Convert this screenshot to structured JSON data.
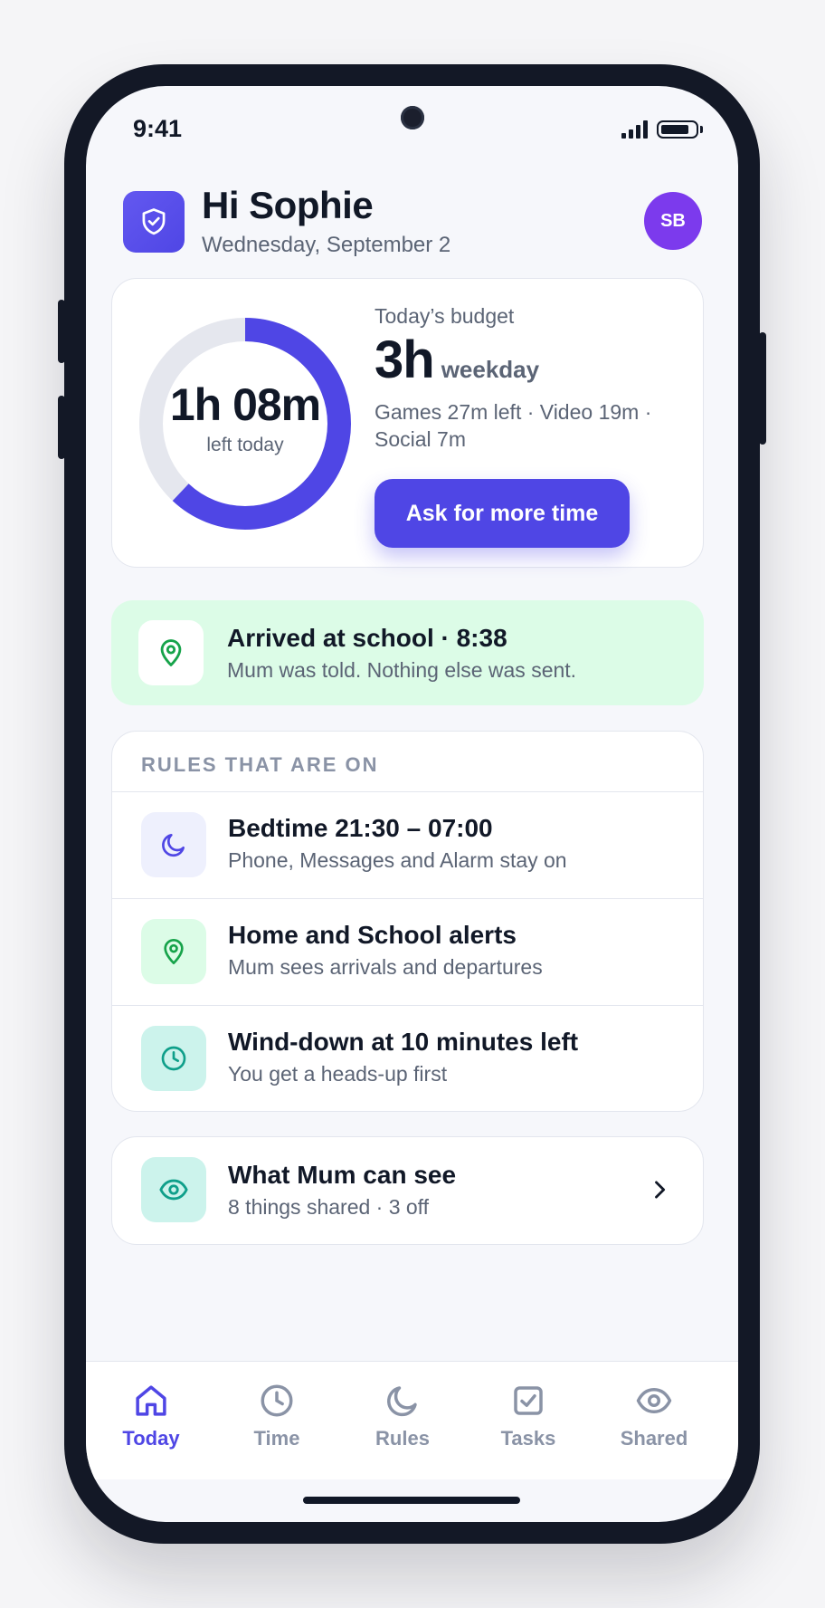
{
  "status": {
    "time": "9:41"
  },
  "header": {
    "greeting": "Hi Sophie",
    "date": "Wednesday, September 2",
    "avatar_initials": "SB"
  },
  "budget": {
    "remaining": "1h 08m",
    "remaining_label": "left today",
    "ring_fraction_remaining": 0.62,
    "label": "Today’s budget",
    "total": "3h",
    "day_type": "weekday",
    "detail": "Games 27m left · Video 19m · Social 7m",
    "ask_button": "Ask for more time"
  },
  "alert": {
    "title": "Arrived at school · 8:38",
    "subtitle": "Mum was told. Nothing else was sent."
  },
  "rules": {
    "heading": "RULES THAT ARE ON",
    "items": [
      {
        "title": "Bedtime 21:30 – 07:00",
        "subtitle": "Phone, Messages and Alarm stay on",
        "icon": "moon-icon"
      },
      {
        "title": "Home and School alerts",
        "subtitle": "Mum sees arrivals and departures",
        "icon": "location-pin-icon"
      },
      {
        "title": "Wind-down at 10 minutes left",
        "subtitle": "You get a heads-up first",
        "icon": "clock-icon"
      }
    ]
  },
  "sharing": {
    "title": "What Mum can see",
    "subtitle": "8 things shared · 3 off"
  },
  "tabs": [
    {
      "label": "Today",
      "icon": "home-icon",
      "active": true
    },
    {
      "label": "Time",
      "icon": "clock-icon",
      "active": false
    },
    {
      "label": "Rules",
      "icon": "moon-icon",
      "active": false
    },
    {
      "label": "Tasks",
      "icon": "checkbox-icon",
      "active": false
    },
    {
      "label": "Shared",
      "icon": "eye-icon",
      "active": false
    }
  ],
  "colors": {
    "accent": "#4f46e5",
    "avatar": "#7c3aed",
    "alert_bg": "#dcfce7",
    "success": "#16a34a",
    "teal": "#0f9f8a"
  }
}
